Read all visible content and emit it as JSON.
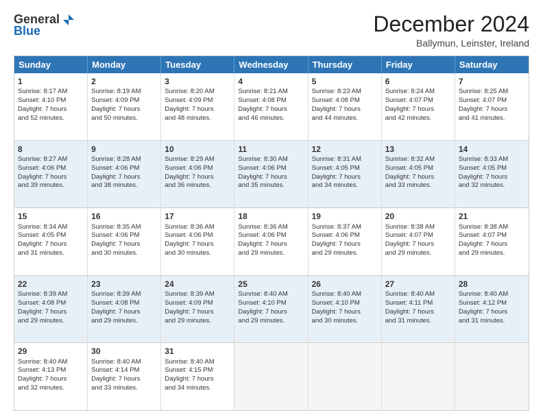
{
  "header": {
    "logo_general": "General",
    "logo_blue": "Blue",
    "title": "December 2024",
    "subtitle": "Ballymun, Leinster, Ireland"
  },
  "calendar": {
    "days": [
      "Sunday",
      "Monday",
      "Tuesday",
      "Wednesday",
      "Thursday",
      "Friday",
      "Saturday"
    ],
    "rows": [
      [
        {
          "num": "1",
          "lines": [
            "Sunrise: 8:17 AM",
            "Sunset: 4:10 PM",
            "Daylight: 7 hours",
            "and 52 minutes."
          ]
        },
        {
          "num": "2",
          "lines": [
            "Sunrise: 8:19 AM",
            "Sunset: 4:09 PM",
            "Daylight: 7 hours",
            "and 50 minutes."
          ]
        },
        {
          "num": "3",
          "lines": [
            "Sunrise: 8:20 AM",
            "Sunset: 4:09 PM",
            "Daylight: 7 hours",
            "and 48 minutes."
          ]
        },
        {
          "num": "4",
          "lines": [
            "Sunrise: 8:21 AM",
            "Sunset: 4:08 PM",
            "Daylight: 7 hours",
            "and 46 minutes."
          ]
        },
        {
          "num": "5",
          "lines": [
            "Sunrise: 8:23 AM",
            "Sunset: 4:08 PM",
            "Daylight: 7 hours",
            "and 44 minutes."
          ]
        },
        {
          "num": "6",
          "lines": [
            "Sunrise: 8:24 AM",
            "Sunset: 4:07 PM",
            "Daylight: 7 hours",
            "and 42 minutes."
          ]
        },
        {
          "num": "7",
          "lines": [
            "Sunrise: 8:25 AM",
            "Sunset: 4:07 PM",
            "Daylight: 7 hours",
            "and 41 minutes."
          ]
        }
      ],
      [
        {
          "num": "8",
          "lines": [
            "Sunrise: 8:27 AM",
            "Sunset: 4:06 PM",
            "Daylight: 7 hours",
            "and 39 minutes."
          ]
        },
        {
          "num": "9",
          "lines": [
            "Sunrise: 8:28 AM",
            "Sunset: 4:06 PM",
            "Daylight: 7 hours",
            "and 38 minutes."
          ]
        },
        {
          "num": "10",
          "lines": [
            "Sunrise: 8:29 AM",
            "Sunset: 4:06 PM",
            "Daylight: 7 hours",
            "and 36 minutes."
          ]
        },
        {
          "num": "11",
          "lines": [
            "Sunrise: 8:30 AM",
            "Sunset: 4:06 PM",
            "Daylight: 7 hours",
            "and 35 minutes."
          ]
        },
        {
          "num": "12",
          "lines": [
            "Sunrise: 8:31 AM",
            "Sunset: 4:05 PM",
            "Daylight: 7 hours",
            "and 34 minutes."
          ]
        },
        {
          "num": "13",
          "lines": [
            "Sunrise: 8:32 AM",
            "Sunset: 4:05 PM",
            "Daylight: 7 hours",
            "and 33 minutes."
          ]
        },
        {
          "num": "14",
          "lines": [
            "Sunrise: 8:33 AM",
            "Sunset: 4:05 PM",
            "Daylight: 7 hours",
            "and 32 minutes."
          ]
        }
      ],
      [
        {
          "num": "15",
          "lines": [
            "Sunrise: 8:34 AM",
            "Sunset: 4:05 PM",
            "Daylight: 7 hours",
            "and 31 minutes."
          ]
        },
        {
          "num": "16",
          "lines": [
            "Sunrise: 8:35 AM",
            "Sunset: 4:06 PM",
            "Daylight: 7 hours",
            "and 30 minutes."
          ]
        },
        {
          "num": "17",
          "lines": [
            "Sunrise: 8:36 AM",
            "Sunset: 4:06 PM",
            "Daylight: 7 hours",
            "and 30 minutes."
          ]
        },
        {
          "num": "18",
          "lines": [
            "Sunrise: 8:36 AM",
            "Sunset: 4:06 PM",
            "Daylight: 7 hours",
            "and 29 minutes."
          ]
        },
        {
          "num": "19",
          "lines": [
            "Sunrise: 8:37 AM",
            "Sunset: 4:06 PM",
            "Daylight: 7 hours",
            "and 29 minutes."
          ]
        },
        {
          "num": "20",
          "lines": [
            "Sunrise: 8:38 AM",
            "Sunset: 4:07 PM",
            "Daylight: 7 hours",
            "and 29 minutes."
          ]
        },
        {
          "num": "21",
          "lines": [
            "Sunrise: 8:38 AM",
            "Sunset: 4:07 PM",
            "Daylight: 7 hours",
            "and 29 minutes."
          ]
        }
      ],
      [
        {
          "num": "22",
          "lines": [
            "Sunrise: 8:39 AM",
            "Sunset: 4:08 PM",
            "Daylight: 7 hours",
            "and 29 minutes."
          ]
        },
        {
          "num": "23",
          "lines": [
            "Sunrise: 8:39 AM",
            "Sunset: 4:08 PM",
            "Daylight: 7 hours",
            "and 29 minutes."
          ]
        },
        {
          "num": "24",
          "lines": [
            "Sunrise: 8:39 AM",
            "Sunset: 4:09 PM",
            "Daylight: 7 hours",
            "and 29 minutes."
          ]
        },
        {
          "num": "25",
          "lines": [
            "Sunrise: 8:40 AM",
            "Sunset: 4:10 PM",
            "Daylight: 7 hours",
            "and 29 minutes."
          ]
        },
        {
          "num": "26",
          "lines": [
            "Sunrise: 8:40 AM",
            "Sunset: 4:10 PM",
            "Daylight: 7 hours",
            "and 30 minutes."
          ]
        },
        {
          "num": "27",
          "lines": [
            "Sunrise: 8:40 AM",
            "Sunset: 4:11 PM",
            "Daylight: 7 hours",
            "and 31 minutes."
          ]
        },
        {
          "num": "28",
          "lines": [
            "Sunrise: 8:40 AM",
            "Sunset: 4:12 PM",
            "Daylight: 7 hours",
            "and 31 minutes."
          ]
        }
      ],
      [
        {
          "num": "29",
          "lines": [
            "Sunrise: 8:40 AM",
            "Sunset: 4:13 PM",
            "Daylight: 7 hours",
            "and 32 minutes."
          ]
        },
        {
          "num": "30",
          "lines": [
            "Sunrise: 8:40 AM",
            "Sunset: 4:14 PM",
            "Daylight: 7 hours",
            "and 33 minutes."
          ]
        },
        {
          "num": "31",
          "lines": [
            "Sunrise: 8:40 AM",
            "Sunset: 4:15 PM",
            "Daylight: 7 hours",
            "and 34 minutes."
          ]
        },
        {
          "num": "",
          "lines": []
        },
        {
          "num": "",
          "lines": []
        },
        {
          "num": "",
          "lines": []
        },
        {
          "num": "",
          "lines": []
        }
      ]
    ],
    "alt_rows": [
      1,
      3
    ]
  }
}
